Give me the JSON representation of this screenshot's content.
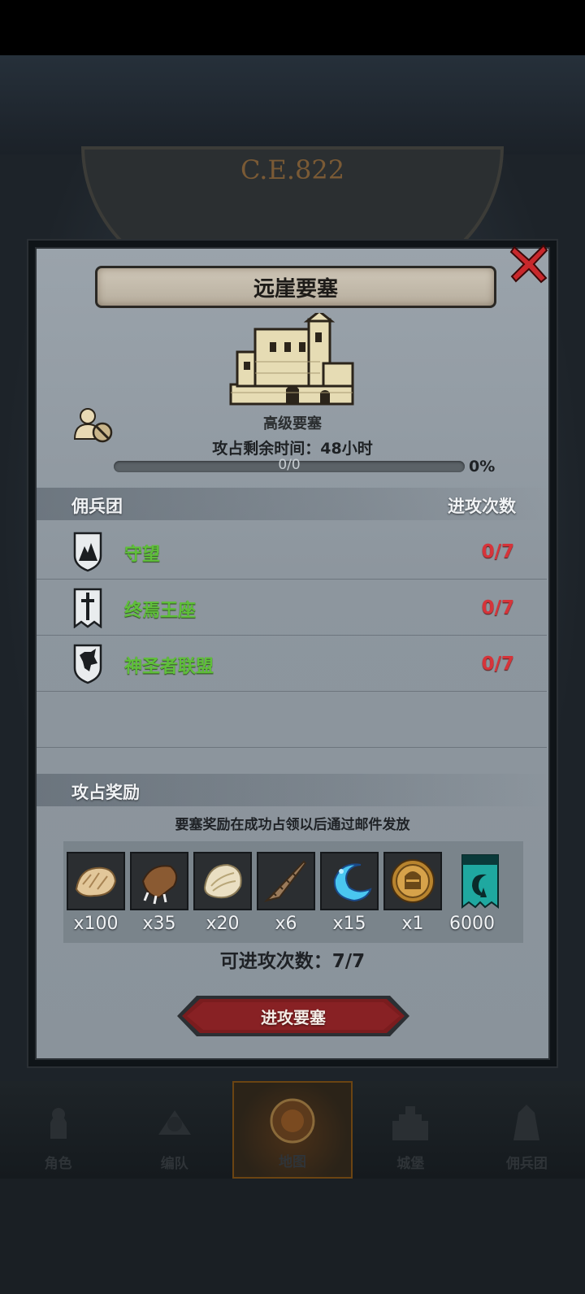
{
  "header": {
    "era": "C.E.822"
  },
  "dialog": {
    "title": "远崖要塞",
    "fortress_type": "高级要塞",
    "time_label": "攻占剩余时间：",
    "time_value": "48小时",
    "progress_text": "0/0",
    "progress_percent": "0%",
    "progress_fraction": 0,
    "icons": {
      "close": "close-icon",
      "fortress": "castle-icon",
      "mercenary_status": "mercenary-disabled-icon"
    }
  },
  "mercenary_section": {
    "left_label": "佣兵团",
    "right_label": "进攻次数",
    "rows": [
      {
        "name": "守望",
        "count": "0/7",
        "icon": "mountain-shield-icon"
      },
      {
        "name": "终焉王座",
        "count": "0/7",
        "icon": "sword-banner-icon"
      },
      {
        "name": "神圣者联盟",
        "count": "0/7",
        "icon": "wolf-shield-icon"
      }
    ]
  },
  "reward_section": {
    "label": "攻占奖励",
    "note": "要塞奖励在成功占领以后通过邮件发放",
    "items": [
      {
        "icon": "fur-icon",
        "qty": "x100"
      },
      {
        "icon": "claw-icon",
        "qty": "x35"
      },
      {
        "icon": "hide-icon",
        "qty": "x20"
      },
      {
        "icon": "horn-icon",
        "qty": "x6"
      },
      {
        "icon": "crescent-icon",
        "qty": "x15"
      },
      {
        "icon": "knight-medal-icon",
        "qty": "x1"
      },
      {
        "icon": "banner-icon",
        "qty": "6000"
      }
    ],
    "attacks_left": "可进攻次数：7/7",
    "attack_button": "进攻要塞"
  },
  "bottom_nav": [
    {
      "label": "角色",
      "icon": "character-icon"
    },
    {
      "label": "编队",
      "icon": "formation-icon"
    },
    {
      "label": "地图",
      "icon": "map-icon",
      "active": true
    },
    {
      "label": "城堡",
      "icon": "castle-nav-icon"
    },
    {
      "label": "佣兵团",
      "icon": "mercenary-nav-icon"
    }
  ],
  "colors": {
    "team_name": "#5fbf3a",
    "attack_count": "#d6343a",
    "button": "#7a1c1e",
    "accent_gold": "#c79a3a"
  }
}
